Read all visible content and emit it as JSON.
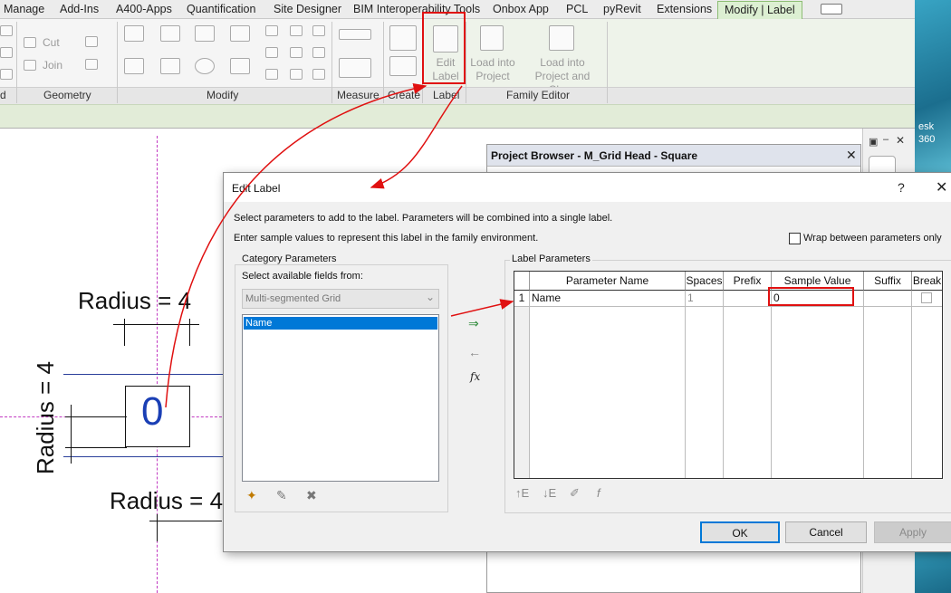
{
  "ribbon": {
    "tabs": [
      "Manage",
      "Add-Ins",
      "A400-Apps",
      "Quantification",
      "Site Designer",
      "BIM Interoperability Tools",
      "Onbox App",
      "PCL",
      "pyRevit",
      "Extensions",
      "Modify | Label"
    ],
    "qat_icon": "window-switch-icon",
    "panels": {
      "partial": "d",
      "geometry": "Geometry",
      "modify": "Modify",
      "measure": "Measure",
      "create": "Create",
      "label": "Label",
      "family_editor": "Family Editor"
    },
    "geometry_buttons": {
      "cut": "Cut",
      "join": "Join"
    },
    "edit_label": "Edit\nLabel",
    "load_into_project": "Load into\nProject",
    "load_into_project_close": "Load into\nProject and Close"
  },
  "canvas": {
    "dim_top": "Radius = 4",
    "dim_left": "Radius = 4",
    "dim_bottom": "Radius = 4",
    "label_sample": "0"
  },
  "sidebar_text": {
    "line1": "esk",
    "line2": "360"
  },
  "project_browser": {
    "title": "Project Browser - M_Grid Head - Square",
    "close": "✕"
  },
  "dialog": {
    "title": "Edit Label",
    "help": "?",
    "close": "✕",
    "instruction1": "Select parameters to add to the label.  Parameters will be combined into a single label.",
    "instruction2": "Enter sample values to represent this label in the family environment.",
    "wrap_label": "Wrap between parameters only",
    "category_group": "Category Parameters",
    "select_fields": "Select available fields from:",
    "category_value": "Multi-segmented Grid",
    "available_fields": [
      "Name"
    ],
    "label_params_group": "Label Parameters",
    "columns": [
      "Parameter Name",
      "Spaces",
      "Prefix",
      "Sample Value",
      "Suffix",
      "Break"
    ],
    "rows": [
      {
        "index": "1",
        "name": "Name",
        "spaces": "1",
        "prefix": "",
        "sample": "0",
        "suffix": "",
        "break": false
      }
    ],
    "fx": "fx",
    "buttons": {
      "ok": "OK",
      "cancel": "Cancel",
      "apply": "Apply"
    }
  },
  "colors": {
    "accent": "#0078d7",
    "annotation": "#e01010",
    "grid_label": "#1a3fb5",
    "reference_plane": "#c23ac2"
  }
}
